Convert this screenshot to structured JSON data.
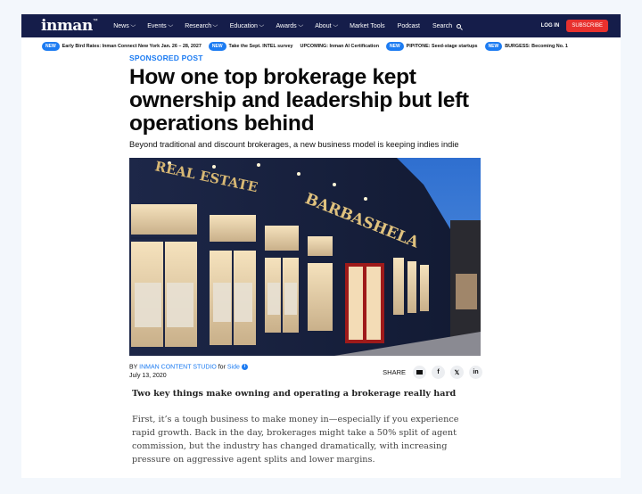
{
  "nav": {
    "logo": "inman",
    "logo_tm": "™",
    "items": [
      {
        "label": "News",
        "dropdown": true
      },
      {
        "label": "Events",
        "dropdown": true
      },
      {
        "label": "Research",
        "dropdown": true
      },
      {
        "label": "Education",
        "dropdown": true
      },
      {
        "label": "Awards",
        "dropdown": true
      },
      {
        "label": "About",
        "dropdown": true
      },
      {
        "label": "Market Tools",
        "dropdown": false
      },
      {
        "label": "Podcast",
        "dropdown": false
      },
      {
        "label": "Search",
        "dropdown": false
      }
    ],
    "login": "LOG IN",
    "subscribe": "SUBSCRIBE"
  },
  "ticker": [
    {
      "badge": "NEW",
      "text": "Early Bird Rates: Inman Connect New York Jan. 26 – 28, 2027"
    },
    {
      "badge": "NEW",
      "text": "Take the Sept. INTEL survey"
    },
    {
      "badge": "",
      "text": "UPCOMING: Inman AI Certification"
    },
    {
      "badge": "NEW",
      "text": "PIPITONE: Seed-stage startups"
    },
    {
      "badge": "NEW",
      "text": "BURGESS: Becoming No. 1"
    }
  ],
  "article": {
    "kicker": "SPONSORED POST",
    "headline": "How one top brokerage kept ownership and leadership but left operations behind",
    "deck": "Beyond traditional and discount brokerages, a new business model is keeping indies indie",
    "hero_sign_left": "REAL ESTATE",
    "hero_sign_right": "BARBASHELA",
    "byline_prefix": "BY",
    "author": "INMAN CONTENT STUDIO",
    "for_text": "for",
    "partner": "Side",
    "info_icon": "i",
    "date": "July 13, 2020",
    "share_label": "SHARE",
    "share_buttons": [
      {
        "icon": "email-icon",
        "glyph": ""
      },
      {
        "icon": "facebook-icon",
        "glyph": "f"
      },
      {
        "icon": "x-icon",
        "glyph": "𝕏"
      },
      {
        "icon": "linkedin-icon",
        "glyph": "in"
      }
    ],
    "subhead": "Two key things make owning and operating a brokerage really hard",
    "paragraph": "First, it’s a tough business to make money in—especially if you experience rapid growth. Back in the day, brokerages might take a 50% split of agent commission, but the industry has changed dramatically, with increasing pressure on aggressive agent splits and lower margins."
  },
  "colors": {
    "nav_bg": "#151d4a",
    "accent": "#1d7cf2",
    "subscribe": "#e8312e"
  }
}
